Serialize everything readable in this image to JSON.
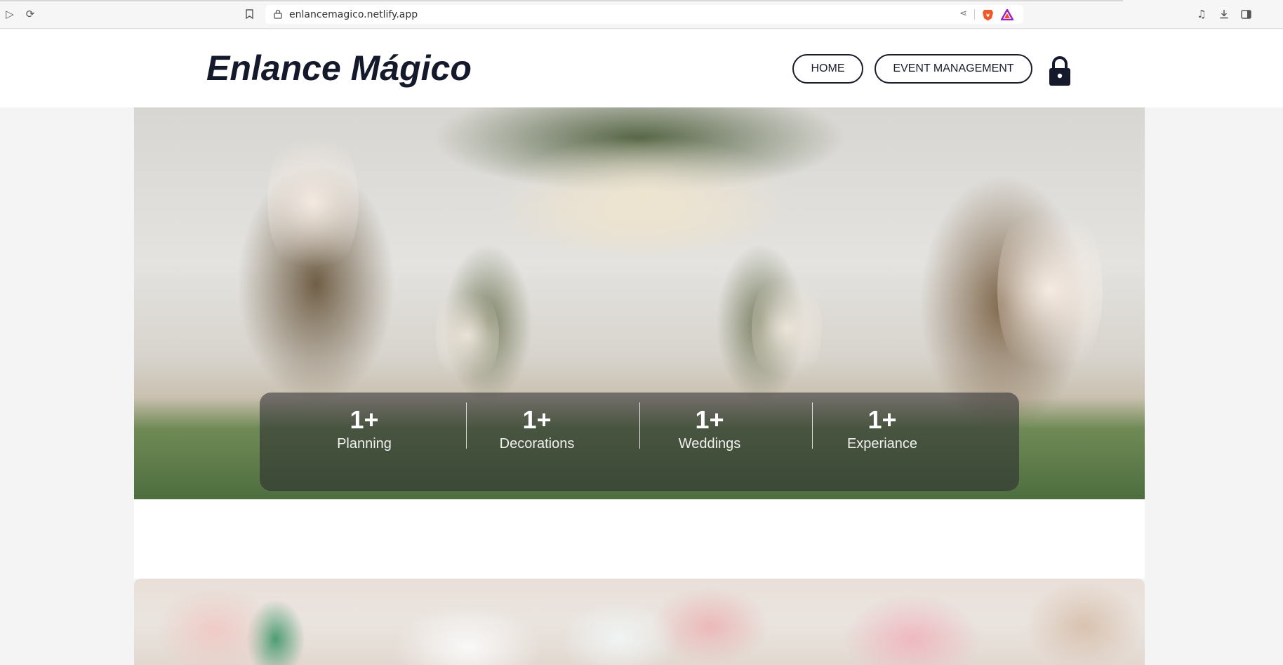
{
  "browser": {
    "url": "enlancemagico.netlify.app",
    "icons": [
      "play-icon",
      "reload-icon",
      "bookmark-icon",
      "lock-icon",
      "share-icon",
      "brave-shield-icon",
      "brave-rewards-icon",
      "media-icon",
      "download-icon",
      "sidebar-icon"
    ]
  },
  "header": {
    "logo": "Enlance Mágico",
    "nav": {
      "home": "HOME",
      "event_management": "EVENT MANAGEMENT"
    },
    "icon": "lock-icon"
  },
  "hero": {
    "stats": [
      {
        "value": "1+",
        "label": "Planning"
      },
      {
        "value": "1+",
        "label": "Decorations"
      },
      {
        "value": "1+",
        "label": "Weddings"
      },
      {
        "value": "1+",
        "label": "Experiance"
      }
    ]
  },
  "colors": {
    "text_dark": "#14192b",
    "page_bg": "#f4f4f4",
    "stats_overlay": "rgba(40,40,45,0.55)"
  }
}
